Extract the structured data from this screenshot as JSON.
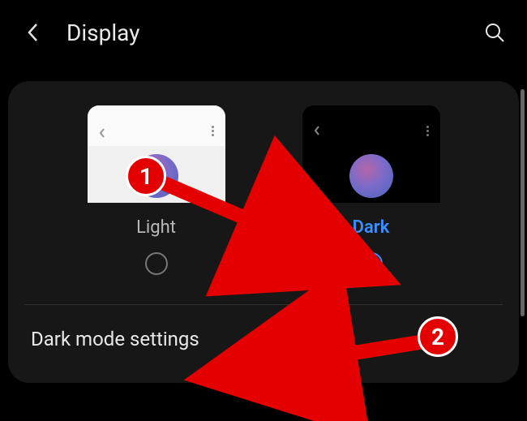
{
  "header": {
    "title": "Display"
  },
  "themes": {
    "light": {
      "label": "Light",
      "selected": false
    },
    "dark": {
      "label": "Dark",
      "selected": true
    }
  },
  "settings": {
    "dark_mode_label": "Dark mode settings"
  },
  "annotations": {
    "callout1": "1",
    "callout2": "2"
  },
  "colors": {
    "accent": "#3a8fff",
    "annotation": "#e40000"
  }
}
